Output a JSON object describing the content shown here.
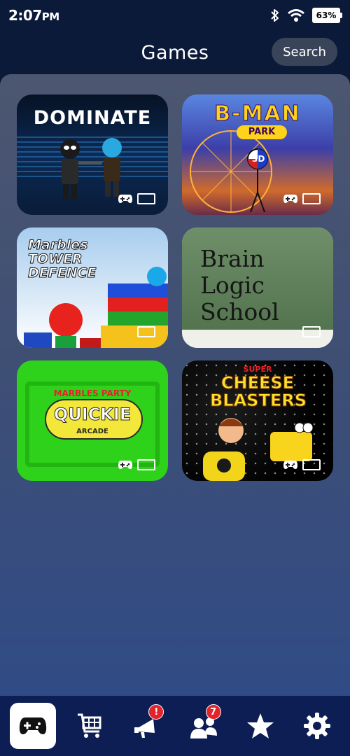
{
  "status_bar": {
    "time": "2:07",
    "period": "PM",
    "battery": "63%"
  },
  "header": {
    "title": "Games",
    "search_label": "Search"
  },
  "games": [
    {
      "title": "DOMINATE",
      "controller_support": true,
      "display": "tv"
    },
    {
      "title": "B-MAN",
      "subtitle": "PARK",
      "badge": "3D",
      "controller_support": true,
      "display": "tv"
    },
    {
      "title": "Marbles TOWER DEFENCE",
      "controller_support": false,
      "display": "tv"
    },
    {
      "title": "Brain Logic School",
      "controller_support": false,
      "display": "tv"
    },
    {
      "title": "QUICKIE",
      "brand": "MARBLES PARTY",
      "subtitle": "ARCADE",
      "controller_support": true,
      "display": "tv"
    },
    {
      "title": "CHEESE BLASTERS",
      "brand": "SUPER",
      "controller_support": true,
      "display": "tv"
    }
  ],
  "bottom_nav": {
    "items": [
      {
        "icon": "gamepad-icon",
        "active": true,
        "badge": ""
      },
      {
        "icon": "cart-icon",
        "active": false,
        "badge": ""
      },
      {
        "icon": "megaphone-icon",
        "active": false,
        "badge": "!"
      },
      {
        "icon": "friends-icon",
        "active": false,
        "badge": "7"
      },
      {
        "icon": "star-icon",
        "active": false,
        "badge": ""
      },
      {
        "icon": "gear-icon",
        "active": false,
        "badge": ""
      }
    ]
  },
  "colors": {
    "background": "#0c1a3a",
    "nav": "#0c1e53",
    "badge": "#e3242b",
    "search_button": "#3a4459"
  }
}
